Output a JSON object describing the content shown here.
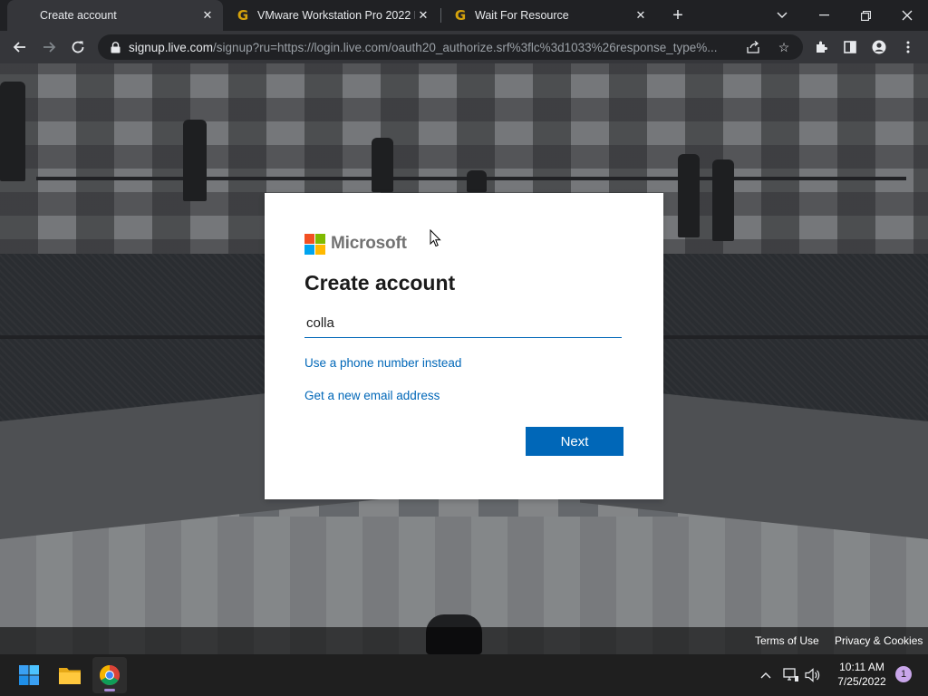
{
  "browser": {
    "tabs": [
      {
        "title": "Create account",
        "active": true,
        "favicon": "microsoft-logo-icon"
      },
      {
        "title": "VMware Workstation Pro 2022 Fr",
        "active": false,
        "favicon": "g-logo-icon"
      },
      {
        "title": "Wait For Resource",
        "active": false,
        "favicon": "g-logo-icon"
      }
    ],
    "url_host": "signup.live.com",
    "url_rest": "/signup?ru=https://login.live.com/oauth20_authorize.srf%3flc%3d1033%26response_type%..."
  },
  "dialog": {
    "brand": "Microsoft",
    "title": "Create account",
    "email_value": "colla",
    "phone_link": "Use a phone number instead",
    "new_email_link": "Get a new email address",
    "next_label": "Next"
  },
  "footer": {
    "terms": "Terms of Use",
    "privacy": "Privacy & Cookies"
  },
  "taskbar": {
    "time": "10:11 AM",
    "date": "7/25/2022",
    "notification_count": "1"
  },
  "colors": {
    "accent": "#0067b8",
    "ms_red": "#f25022",
    "ms_green": "#7fba00",
    "ms_blue": "#00a4ef",
    "ms_yellow": "#ffb900"
  }
}
